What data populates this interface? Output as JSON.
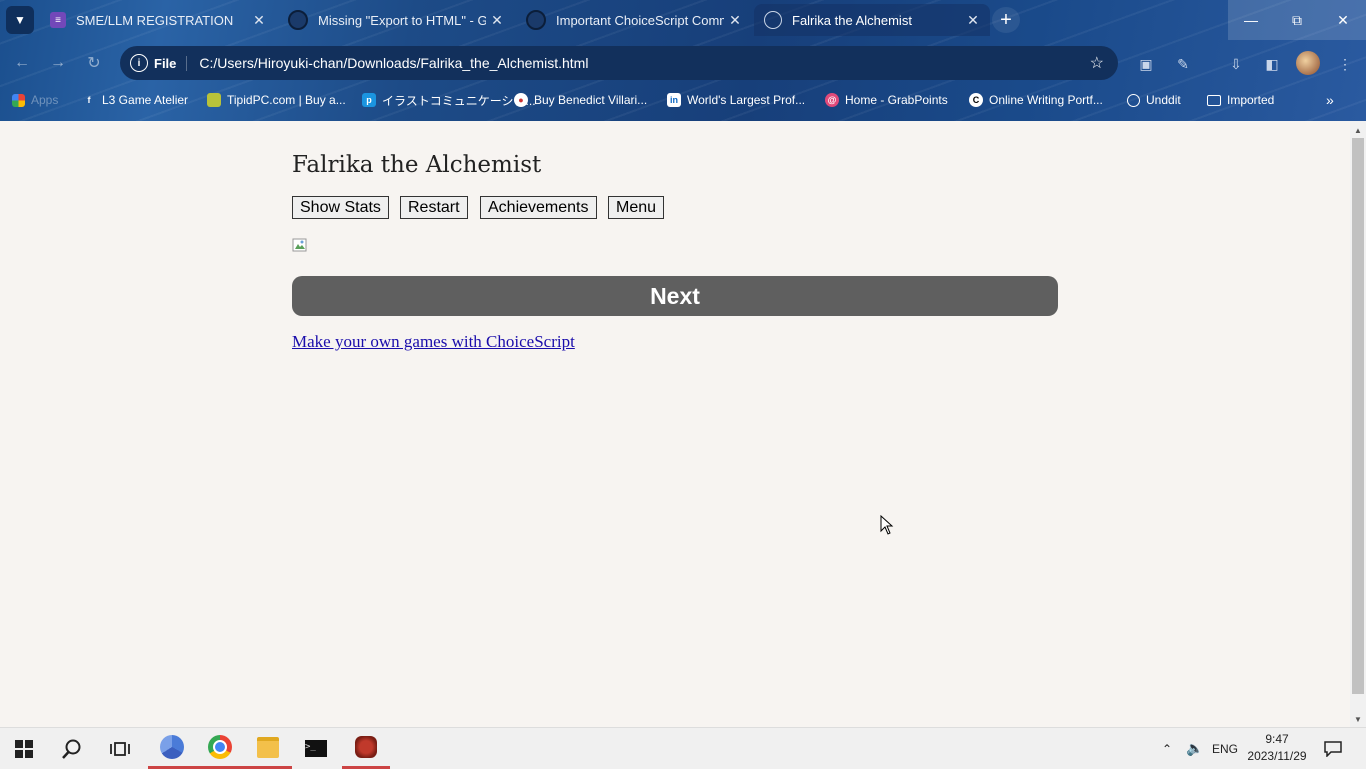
{
  "browser": {
    "tabs": [
      {
        "title": "SME/LLM REGISTRATION",
        "favicon": "list-icon",
        "active": false
      },
      {
        "title": "Missing \"Export to HTML\" - Gam",
        "favicon": "forum-icon",
        "active": false
      },
      {
        "title": "Important ChoiceScript Comm...",
        "favicon": "forum-icon",
        "active": false
      },
      {
        "title": "Falrika the Alchemist",
        "favicon": "globe-icon",
        "active": true
      }
    ],
    "address": {
      "scheme_label": "File",
      "url": "C:/Users/Hiroyuki-chan/Downloads/Falrika_the_Alchemist.html"
    },
    "bookmarks": [
      {
        "label": "Apps",
        "icon": "apps-grid-icon"
      },
      {
        "label": "L3 Game Atelier",
        "icon": "facebook-icon"
      },
      {
        "label": "TipidPC.com | Buy a...",
        "icon": "tipidpc-icon"
      },
      {
        "label": "イラストコミュニケーショ...",
        "icon": "pixiv-icon"
      },
      {
        "label": "Buy Benedict Villari...",
        "icon": "patreon-icon"
      },
      {
        "label": "World's Largest Prof...",
        "icon": "linkedin-icon"
      },
      {
        "label": "Home - GrabPoints",
        "icon": "grabpoints-icon"
      },
      {
        "label": "Online Writing Portf...",
        "icon": "contently-icon"
      },
      {
        "label": "Unddit",
        "icon": "globe-icon"
      },
      {
        "label": "Imported",
        "icon": "folder-icon"
      }
    ]
  },
  "game": {
    "title": "Falrika the Alchemist",
    "buttons": {
      "stats": "Show Stats",
      "restart": "Restart",
      "achievements": "Achievements",
      "menu": "Menu"
    },
    "next_label": "Next",
    "footer_link": "Make your own games with ChoiceScript"
  },
  "taskbar": {
    "language": "ENG",
    "time": "9:47",
    "date": "2023/11/29"
  },
  "colors": {
    "page_bg": "#f7f4f1",
    "next_button": "#5f5f5f",
    "link": "#1a0dab"
  }
}
